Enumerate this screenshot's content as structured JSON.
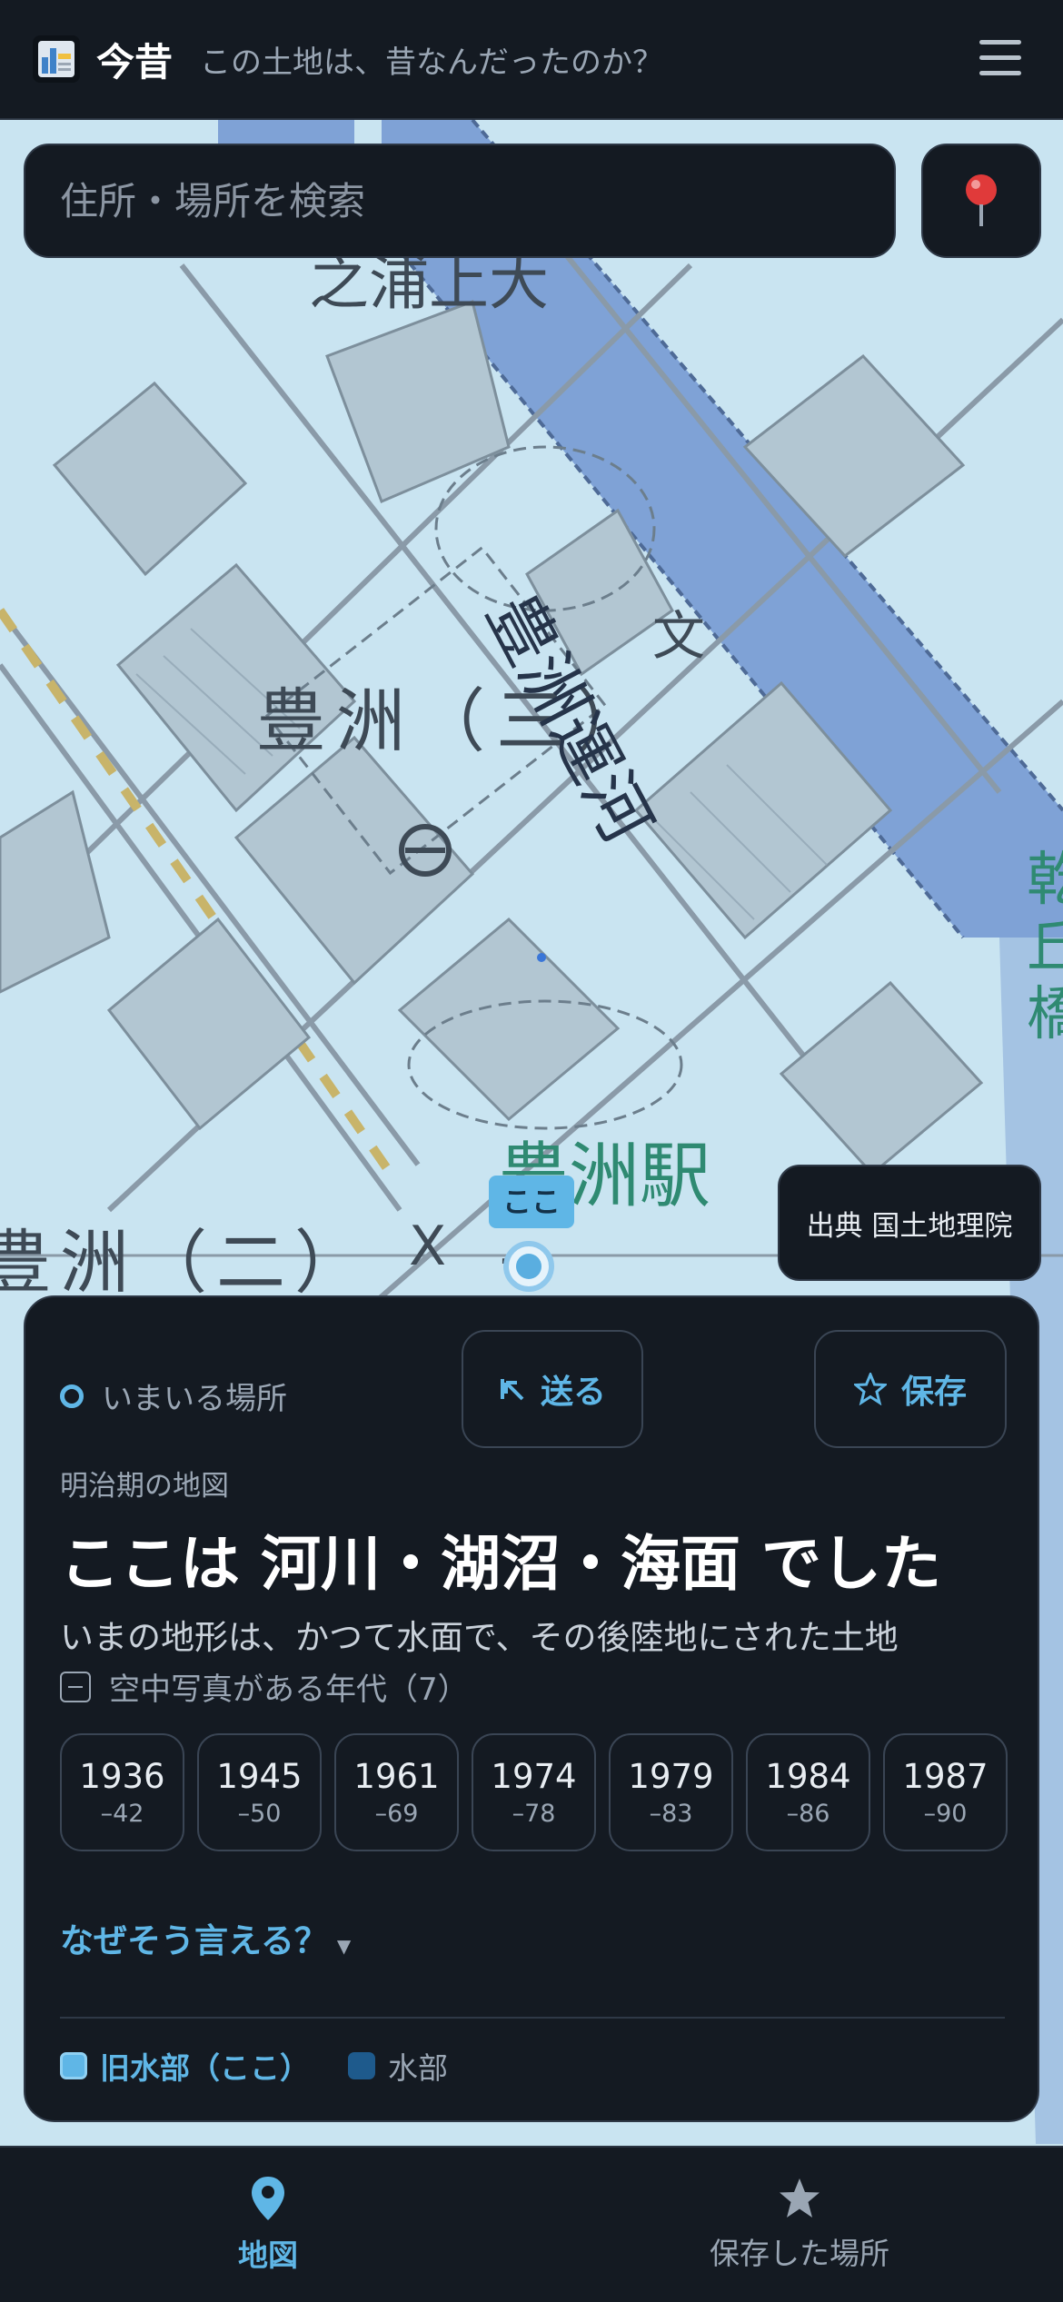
{
  "header": {
    "app_name": "今昔",
    "tagline": "この土地は、昔なんだったのか？",
    "logo_icon": "map-book-icon",
    "menu_icon": "hamburger-menu-icon"
  },
  "search": {
    "placeholder": "住所・場所を検索",
    "value": "",
    "locate_icon": "pin-icon"
  },
  "map": {
    "labels": {
      "district_3": "豊洲（三）",
      "district_2": "豊洲（二）",
      "canal": "豊洲運河",
      "station": "豊洲駅",
      "top_partial": "之浦上大",
      "right_partial": "乾 丘 橋"
    },
    "here_tag": "ここ",
    "attribution": "出典 国土地理院"
  },
  "sheet": {
    "current_location": "いまいる場所",
    "send_label": "送る",
    "save_label": "保存",
    "era_label": "明治期の地図",
    "headline": "ここは 河川・湖沼・海面 でした",
    "description": "いまの地形は、かつて水面で、その後陸地にされた土地",
    "aerial_label": "空中写真がある年代（7）",
    "years": [
      {
        "year": "1936",
        "range": "–42"
      },
      {
        "year": "1945",
        "range": "–50"
      },
      {
        "year": "1961",
        "range": "–69"
      },
      {
        "year": "1974",
        "range": "–78"
      },
      {
        "year": "1979",
        "range": "–83"
      },
      {
        "year": "1984",
        "range": "–86"
      },
      {
        "year": "1987",
        "range": "–90"
      }
    ],
    "why_link": "なぜそう言える？",
    "legend": {
      "former_water": "旧水部（ここ）",
      "water": "水部"
    }
  },
  "tabs": {
    "map_label": "地図",
    "saved_label": "保存した場所"
  },
  "colors": {
    "accent": "#5fb6e6",
    "panel": "#141a22",
    "map_water": "#7fa2d6"
  }
}
